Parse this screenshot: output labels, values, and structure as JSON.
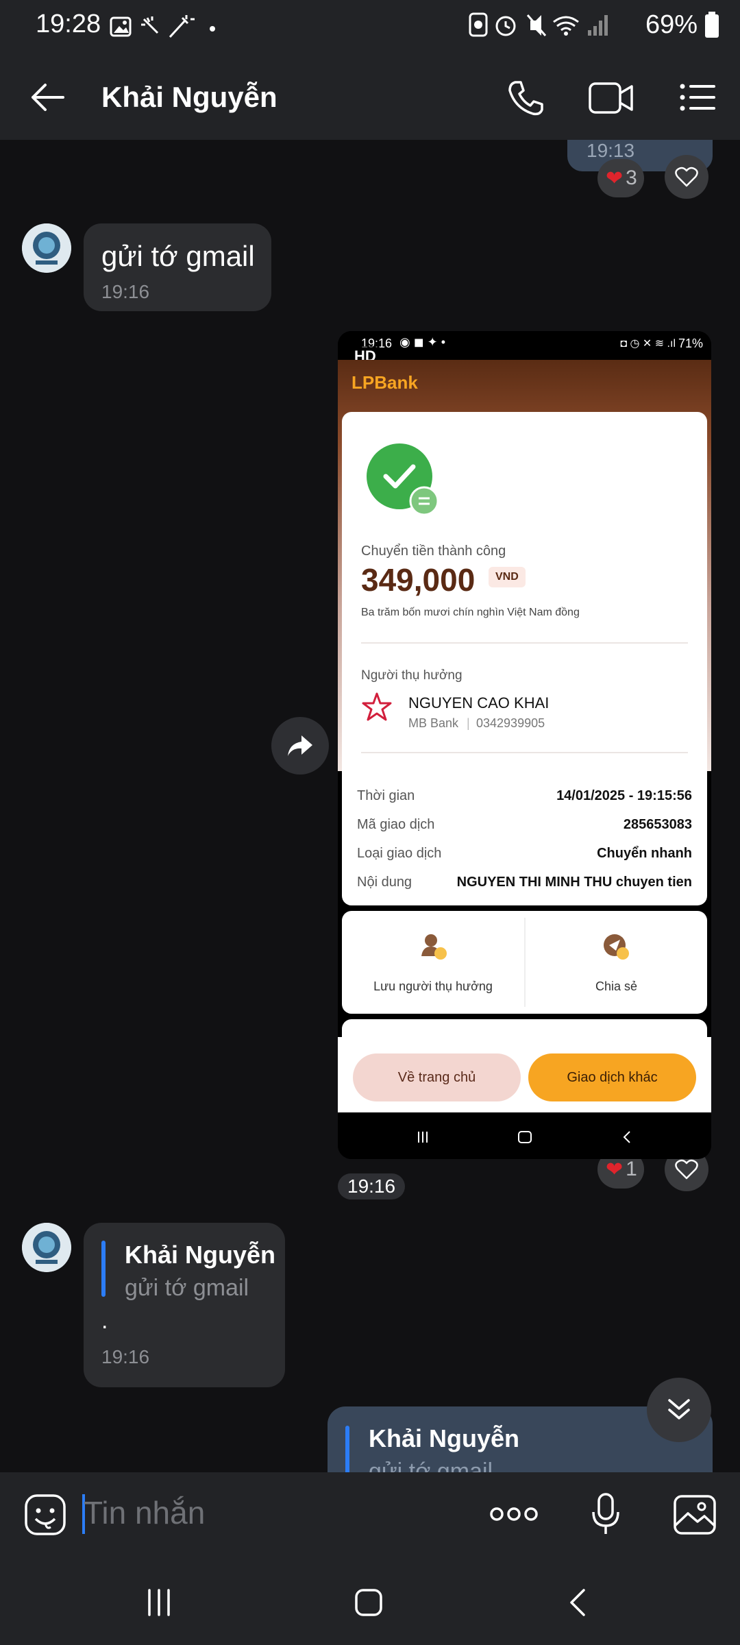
{
  "status_bar": {
    "time": "19:28",
    "battery": "69%"
  },
  "header": {
    "contact_name": "Khải Nguyễn"
  },
  "messages": {
    "top_partial_time": "19:13",
    "top_reaction_count": "3",
    "msg1_text": "gửi tớ gmail",
    "msg1_time": "19:16",
    "image_badge": "HD",
    "image_reaction_count": "1",
    "image_time": "19:16",
    "reply1_quote_name": "Khải Nguyễn",
    "reply1_quote_text": "gửi tớ gmail",
    "reply1_text": ".",
    "reply1_time": "19:16",
    "reply2_quote_name": "Khải Nguyễn",
    "reply2_quote_text": "gửi tớ gmail"
  },
  "shot": {
    "status_time": "19:16",
    "status_battery": "71%",
    "bank_logo": "LPBank",
    "success_label": "Chuyển tiền thành công",
    "amount": "349,000",
    "currency": "VND",
    "amount_words": "Ba trăm bốn mươi chín nghìn Việt Nam đồng",
    "beneficiary_label": "Người thụ hưởng",
    "beneficiary_name": "NGUYEN CAO KHAI",
    "beneficiary_bank": "MB Bank",
    "beneficiary_account": "0342939905",
    "rows": [
      {
        "label": "Thời gian",
        "value": "14/01/2025 - 19:15:56"
      },
      {
        "label": "Mã giao dịch",
        "value": "285653083"
      },
      {
        "label": "Loại giao dịch",
        "value": "Chuyển nhanh"
      },
      {
        "label": "Nội dung",
        "value": "NGUYEN THI MINH THU chuyen tien"
      }
    ],
    "save_beneficiary": "Lưu người thụ hưởng",
    "share": "Chia sẻ",
    "btn_home": "Về trang chủ",
    "btn_other": "Giao dịch khác"
  },
  "input": {
    "placeholder": "Tin nhắn"
  },
  "colors": {
    "bubble_incoming": "#2b2c2f",
    "bubble_outgoing": "#39475a",
    "accent": "#2c7df6",
    "heart": "#e0242c"
  }
}
